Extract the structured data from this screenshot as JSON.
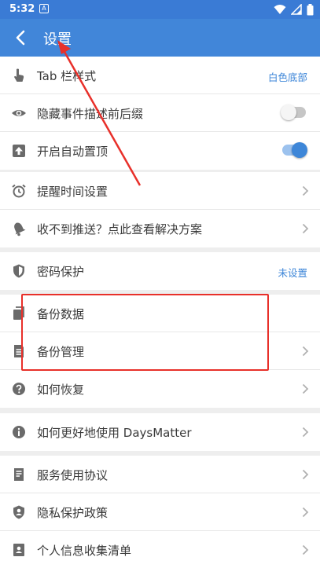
{
  "status": {
    "time": "5:32",
    "notif_glyph": "A"
  },
  "appbar": {
    "title": "设置"
  },
  "sections": [
    {
      "items": [
        {
          "label": "Tab 栏样式",
          "value": "白色底部",
          "icon": "tab-touch-icon"
        },
        {
          "label": "隐藏事件描述前后缀",
          "toggle": false,
          "icon": "eye-icon"
        },
        {
          "label": "开启自动置顶",
          "toggle": true,
          "icon": "upload-top-icon"
        }
      ]
    },
    {
      "items": [
        {
          "label": "提醒时间设置",
          "icon": "alarm-clock-icon"
        },
        {
          "label": "收不到推送？点此查看解决方案",
          "icon": "bell-icon"
        }
      ]
    },
    {
      "items": [
        {
          "label": "密码保护",
          "value": "未设置",
          "icon": "shield-icon"
        }
      ]
    },
    {
      "items": [
        {
          "label": "备份数据",
          "icon": "copy-icon"
        },
        {
          "label": "备份管理",
          "icon": "document-icon"
        },
        {
          "label": "如何恢复",
          "icon": "help-icon"
        }
      ]
    },
    {
      "items": [
        {
          "label": "如何更好地使用 DaysMatter",
          "icon": "info-icon"
        }
      ]
    },
    {
      "items": [
        {
          "label": "服务使用协议",
          "icon": "agreement-icon"
        },
        {
          "label": "隐私保护政策",
          "icon": "privacy-icon"
        },
        {
          "label": "个人信息收集清单",
          "icon": "personal-info-icon"
        }
      ]
    }
  ],
  "colors": {
    "accent": "#4186d9",
    "annotation": "#e8302a"
  }
}
